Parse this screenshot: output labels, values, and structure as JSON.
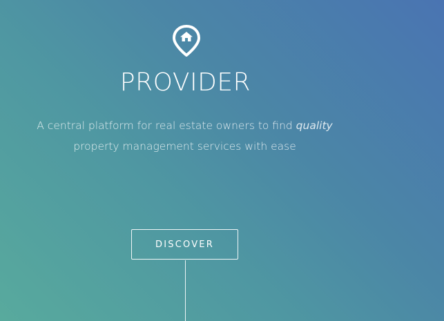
{
  "hero": {
    "icon": "home-location-pin-icon",
    "title": "PROVIDER",
    "tagline_part1": "A central platform for real estate owners to find ",
    "tagline_emphasis": "quality",
    "tagline_part2": "property management services with ease",
    "discover_label": "DISCOVER"
  },
  "colors": {
    "gradient_top_right": "#4a74b2",
    "gradient_bottom_left": "#58aa9d",
    "text": "#ffffff"
  }
}
